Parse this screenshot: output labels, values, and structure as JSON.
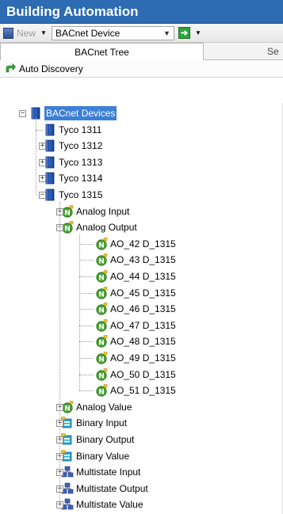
{
  "window": {
    "title": "Building Automation"
  },
  "toolbar": {
    "new_label": "New",
    "device_combo_value": "BACnet Device"
  },
  "tabs": [
    {
      "label": "BACnet Tree"
    },
    {
      "label": "Se"
    }
  ],
  "auto_discovery": {
    "label": "Auto Discovery"
  },
  "tree": {
    "root": "BACnet Devices",
    "devices": [
      "Tyco 1311",
      "Tyco 1312",
      "Tyco 1313",
      "Tyco 1314",
      "Tyco 1315"
    ],
    "objects_top": [
      "Analog Input",
      "Analog Output"
    ],
    "analog_outputs": [
      "AO_42 D_1315",
      "AO_43 D_1315",
      "AO_44 D_1315",
      "AO_45 D_1315",
      "AO_46 D_1315",
      "AO_47 D_1315",
      "AO_48 D_1315",
      "AO_49 D_1315",
      "AO_50 D_1315",
      "AO_51 D_1315"
    ],
    "objects_bottom": [
      "Analog Value",
      "Binary Input",
      "Binary Output",
      "Binary Value",
      "Multistate Input",
      "Multistate Output",
      "Multistate Value"
    ]
  },
  "colors": {
    "title_bar": "#2d6bb3",
    "selection": "#3d7fd6",
    "device_icon": "#1f4fa0",
    "analog_icon": "#3a9a2a"
  }
}
